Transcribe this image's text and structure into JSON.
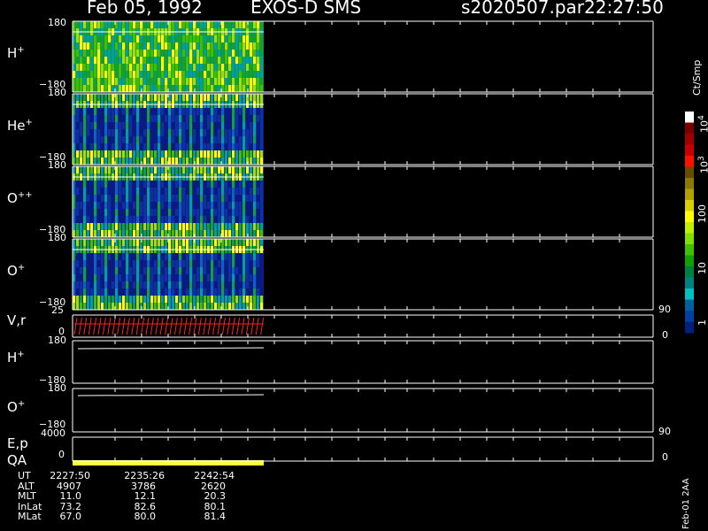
{
  "header": {
    "date": "Feb 05, 1992",
    "mission": "EXOS-D SMS",
    "file": "s2020507.par",
    "time": "22:27:50"
  },
  "panels": [
    {
      "label": "H",
      "sup": "+",
      "ymax": "180",
      "ymin": "−180"
    },
    {
      "label": "He",
      "sup": "+",
      "ymax": "180",
      "ymin": "−180"
    },
    {
      "label": "O",
      "sup": "++",
      "ymax": "180",
      "ymin": "−180"
    },
    {
      "label": "O",
      "sup": "+",
      "ymax": "180",
      "ymin": "−180"
    }
  ],
  "vr_panel": {
    "label": "V,r",
    "ymax": "25",
    "ymin": "0",
    "rmax": "90",
    "rmin": "0"
  },
  "h_line_panel": {
    "label": "H",
    "sup": "+",
    "ymax": "180",
    "ymin": "−180"
  },
  "o_line_panel": {
    "label": "O",
    "sup": "+",
    "ymax": "180",
    "ymin": "−180"
  },
  "ep_panel": {
    "label": "E,p",
    "ymax": "4000",
    "ymin": "0",
    "rmax": "90",
    "rmin": "0"
  },
  "qa_label": "QA",
  "colorbar": {
    "title": "Ct/Smp",
    "labels": [
      "10",
      "10",
      "100",
      "10",
      "1"
    ],
    "sups": [
      "4",
      "3",
      "",
      "",
      ""
    ],
    "colors": [
      "#ffffff",
      "#7a0000",
      "#a00000",
      "#c80000",
      "#ff1000",
      "#6a4a00",
      "#8a7a00",
      "#b0a000",
      "#d8d000",
      "#ffff00",
      "#c0f000",
      "#80e000",
      "#40c000",
      "#10a000",
      "#008040",
      "#008080",
      "#00c0c0",
      "#0060a0",
      "#0040a0",
      "#002080"
    ]
  },
  "ephemeris": {
    "rows": [
      {
        "name": "UT",
        "values": [
          "2227:50",
          "2235:26",
          "2242:54"
        ]
      },
      {
        "name": "ALT",
        "values": [
          "4907",
          "3786",
          "2620"
        ]
      },
      {
        "name": "MLT",
        "values": [
          "11.0",
          "12.1",
          "20.3"
        ]
      },
      {
        "name": "InLat",
        "values": [
          "73.2",
          "82.6",
          "80.1"
        ]
      },
      {
        "name": "MLat",
        "values": [
          "67.0",
          "80.0",
          "81.4"
        ]
      }
    ]
  },
  "footer_code": "Feb-01 2AA"
}
